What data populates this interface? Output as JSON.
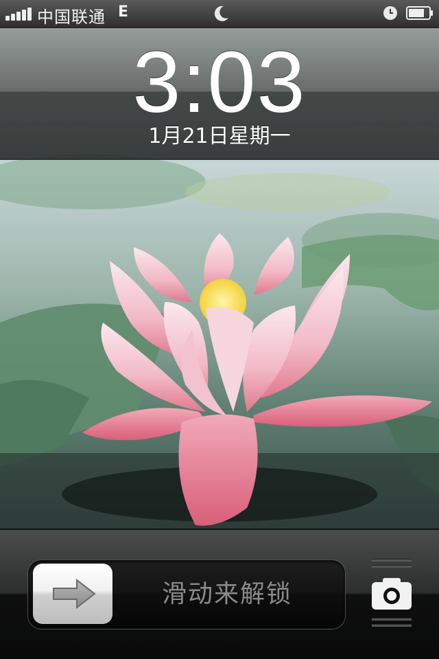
{
  "status_bar": {
    "carrier": "中国联通",
    "network": "E",
    "do_not_disturb_icon": "moon-icon",
    "alarm_icon": "clock-icon",
    "battery_icon": "battery-icon",
    "signal_bars": 5,
    "battery_level": 0.75
  },
  "lock_screen": {
    "time": "3:03",
    "date": "1月21日星期一"
  },
  "unlock": {
    "slider_label": "滑动来解锁",
    "knob_icon": "arrow-right-icon",
    "camera_icon": "camera-icon"
  },
  "colors": {
    "status_text": "#f2f2f2",
    "time_text": "#ffffff",
    "slider_label": "#8a8a8a",
    "lotus_pink": "#e8879a",
    "lotus_center": "#f6d84a",
    "lily_pad": "#6f9a78"
  }
}
